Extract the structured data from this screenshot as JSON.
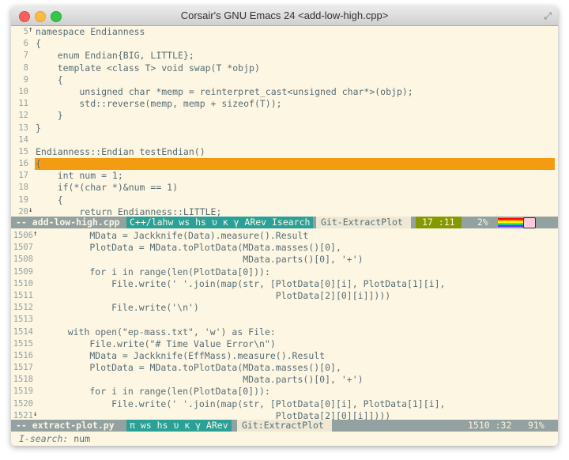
{
  "window": {
    "title": "Corsair's GNU Emacs 24 <add-low-high.cpp>"
  },
  "pane1": {
    "lines": [
      {
        "num": "5",
        "fringe": "↑",
        "text": "namespace Endianness"
      },
      {
        "num": "6",
        "text": "{"
      },
      {
        "num": "7",
        "text": "    enum Endian{BIG, LITTLE};"
      },
      {
        "num": "8",
        "text": "    template <class T> void swap(T *objp)"
      },
      {
        "num": "9",
        "text": "    {"
      },
      {
        "num": "10",
        "text": "        unsigned char *memp = reinterpret_cast<unsigned char*>(objp);"
      },
      {
        "num": "11",
        "text": "        std::reverse(memp, memp + sizeof(T));"
      },
      {
        "num": "12",
        "text": "    }"
      },
      {
        "num": "13",
        "text": "}"
      },
      {
        "num": "14",
        "text": ""
      },
      {
        "num": "15",
        "text": "Endianness::Endian testEndian()"
      },
      {
        "num": "16",
        "text": "{"
      },
      {
        "num": "17",
        "text": "    int num = 1;"
      },
      {
        "num": "18",
        "text": "    if(*(char *)&num == 1)"
      },
      {
        "num": "19",
        "text": "    {"
      },
      {
        "num": "20",
        "fringe": "↓",
        "text": "        return Endianness::LITTLE;"
      }
    ],
    "modeline": {
      "buffer": "-- add-low-high.cpp",
      "mode": "C++/lahw ws hs υ κ γ ARev Isearch",
      "git": "Git-ExtractPlot",
      "position": "17 :11",
      "percent": "2%"
    }
  },
  "pane2": {
    "lines": [
      {
        "num": "1506",
        "fringe": "↑",
        "text": "        MData = Jackknife(Data).measure().Result"
      },
      {
        "num": "1507",
        "text": "        PlotData = MData.toPlotData(MData.masses()[0],"
      },
      {
        "num": "1508",
        "text": "                                    MData.parts()[0], '+')"
      },
      {
        "num": "1509",
        "text": "        for i in range(len(PlotData[0])):"
      },
      {
        "num": "1510",
        "text": "            File.write(' '.join(map(str, [PlotData[0][i], PlotData[1][i],"
      },
      {
        "num": "1511",
        "text": "                                          PlotData[2][0][i]])))"
      },
      {
        "num": "1512",
        "text": "            File.write('\\n')"
      },
      {
        "num": "1513",
        "text": ""
      },
      {
        "num": "1514",
        "text": "    with open(\"ep-mass.txt\", 'w') as File:"
      },
      {
        "num": "1515",
        "text": "        File.write(\"# Time Value Error\\n\")"
      },
      {
        "num": "1516",
        "text": "        MData = Jackknife(EffMass).measure().Result"
      },
      {
        "num": "1517",
        "text": "        PlotData = MData.toPlotData(MData.masses()[0],"
      },
      {
        "num": "1518",
        "text": "                                    MData.parts()[0], '+')"
      },
      {
        "num": "1519",
        "text": "        for i in range(len(PlotData[0])):"
      },
      {
        "num": "1520",
        "text": "            File.write(' '.join(map(str, [PlotData[0][i], PlotData[1][i],"
      },
      {
        "num": "1521",
        "fringe": "↓",
        "text": "                                          PlotData[2][0][i]])))"
      }
    ],
    "modeline": {
      "buffer": "-- extract-plot.py",
      "mode": "π ws hs υ κ γ ARev",
      "git": "Git:ExtractPlot",
      "position": "1510 :32",
      "percent": "91%"
    }
  },
  "echo": {
    "label": "I-search:",
    "query": "num"
  },
  "colors": {
    "background": "#fdf6e3",
    "highlight": "#f39c12",
    "modeline": "#93a1a1",
    "mode_segment": "#2aa198",
    "position_segment": "#859900"
  }
}
